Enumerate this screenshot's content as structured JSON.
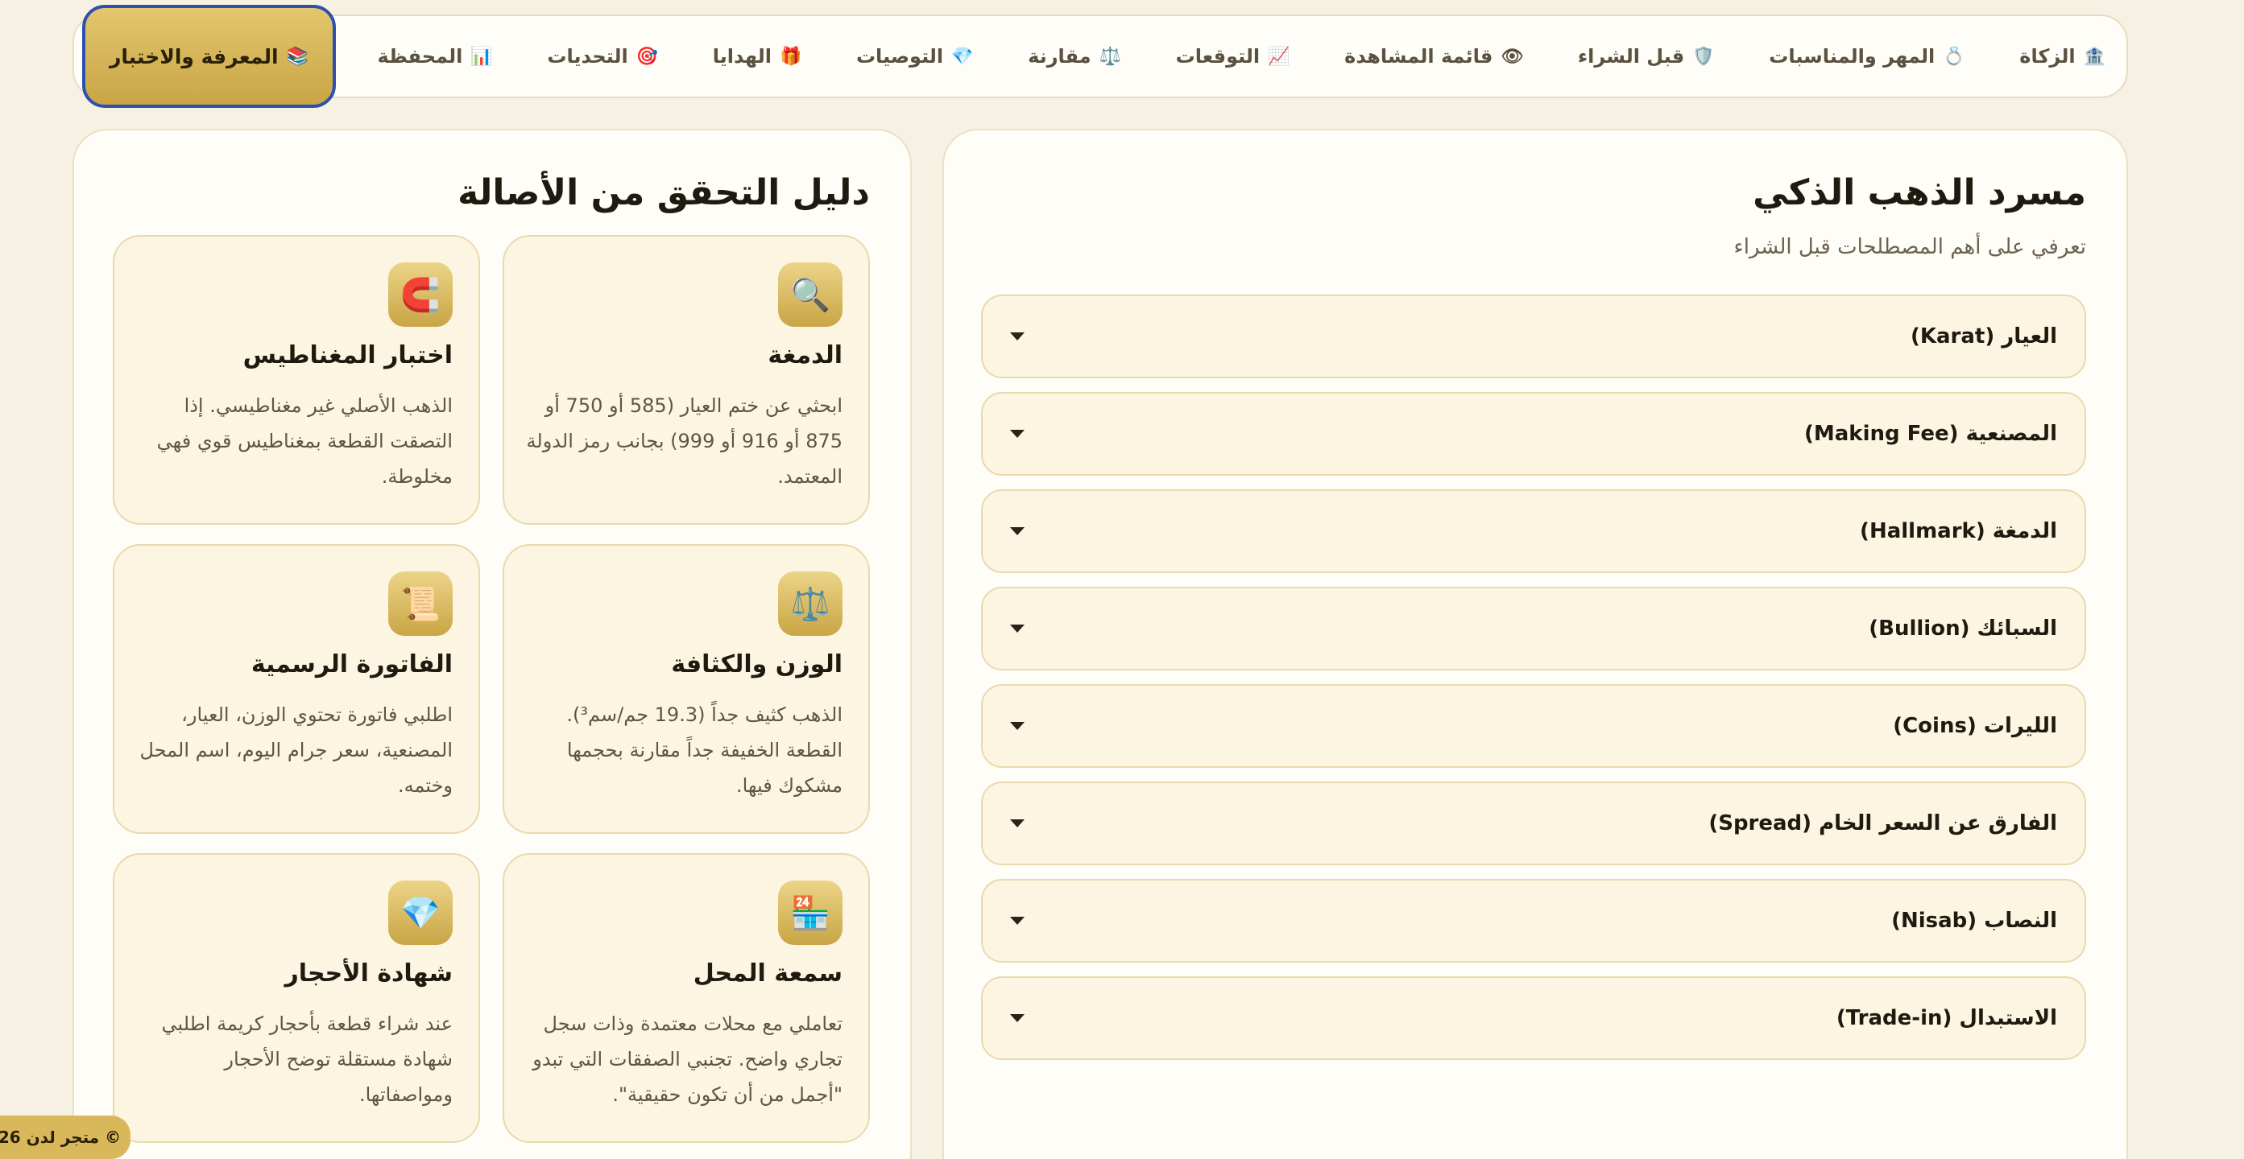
{
  "nav": {
    "items": [
      {
        "icon": "🏦",
        "label": "الزكاة"
      },
      {
        "icon": "💍",
        "label": "المهر والمناسبات"
      },
      {
        "icon": "🛡️",
        "label": "قبل الشراء"
      },
      {
        "icon": "👁",
        "label": "قائمة المشاهدة"
      },
      {
        "icon": "📈",
        "label": "التوقعات"
      },
      {
        "icon": "⚖️",
        "label": "مقارنة"
      },
      {
        "icon": "💎",
        "label": "التوصيات"
      },
      {
        "icon": "🎁",
        "label": "الهدايا"
      },
      {
        "icon": "🎯",
        "label": "التحديات"
      },
      {
        "icon": "📊",
        "label": "المحفظة"
      },
      {
        "icon": "📚",
        "label": "المعرفة والاختبار"
      }
    ],
    "active_index": 10
  },
  "glossary": {
    "title": "مسرد الذهب الذكي",
    "subtitle": "تعرفي على أهم المصطلحات قبل الشراء",
    "items": [
      {
        "label": "العيار (Karat)"
      },
      {
        "label": "المصنعية (Making Fee)"
      },
      {
        "label": "الدمغة (Hallmark)"
      },
      {
        "label": "السبائك (Bullion)"
      },
      {
        "label": "الليرات (Coins)"
      },
      {
        "label": "الفارق عن السعر الخام (Spread)"
      },
      {
        "label": "النصاب (Nisab)"
      },
      {
        "label": "الاستبدال (Trade-in)"
      }
    ]
  },
  "guide": {
    "title": "دليل التحقق من الأصالة",
    "cards": [
      {
        "icon": "🔍",
        "title": "الدمغة",
        "text": "ابحثي عن ختم العيار (585 أو 750 أو 875 أو 916 أو 999) بجانب رمز الدولة المعتمد."
      },
      {
        "icon": "🧲",
        "title": "اختبار المغناطيس",
        "text": "الذهب الأصلي غير مغناطيسي. إذا التصقت القطعة بمغناطيس قوي فهي مخلوطة."
      },
      {
        "icon": "⚖️",
        "title": "الوزن والكثافة",
        "text": "الذهب كثيف جداً (19.3 جم/سم³). القطعة الخفيفة جداً مقارنة بحجمها مشكوك فيها."
      },
      {
        "icon": "📜",
        "title": "الفاتورة الرسمية",
        "text": "اطلبي فاتورة تحتوي الوزن، العيار، المصنعية، سعر جرام اليوم، اسم المحل وختمه."
      },
      {
        "icon": "🏪",
        "title": "سمعة المحل",
        "text": "تعاملي مع محلات معتمدة وذات سجل تجاري واضح. تجنبي الصفقات التي تبدو \"أجمل من أن تكون حقيقية\"."
      },
      {
        "icon": "💎",
        "title": "شهادة الأحجار",
        "text": "عند شراء قطعة بأحجار كريمة اطلبي شهادة مستقلة توضح الأحجار ومواصفاتها."
      }
    ]
  },
  "footer": {
    "badge": "© متجر لدن 26"
  },
  "colors": {
    "accent": "#c9a545",
    "active_border": "#2d4fb0",
    "background": "#f7f1e3"
  }
}
